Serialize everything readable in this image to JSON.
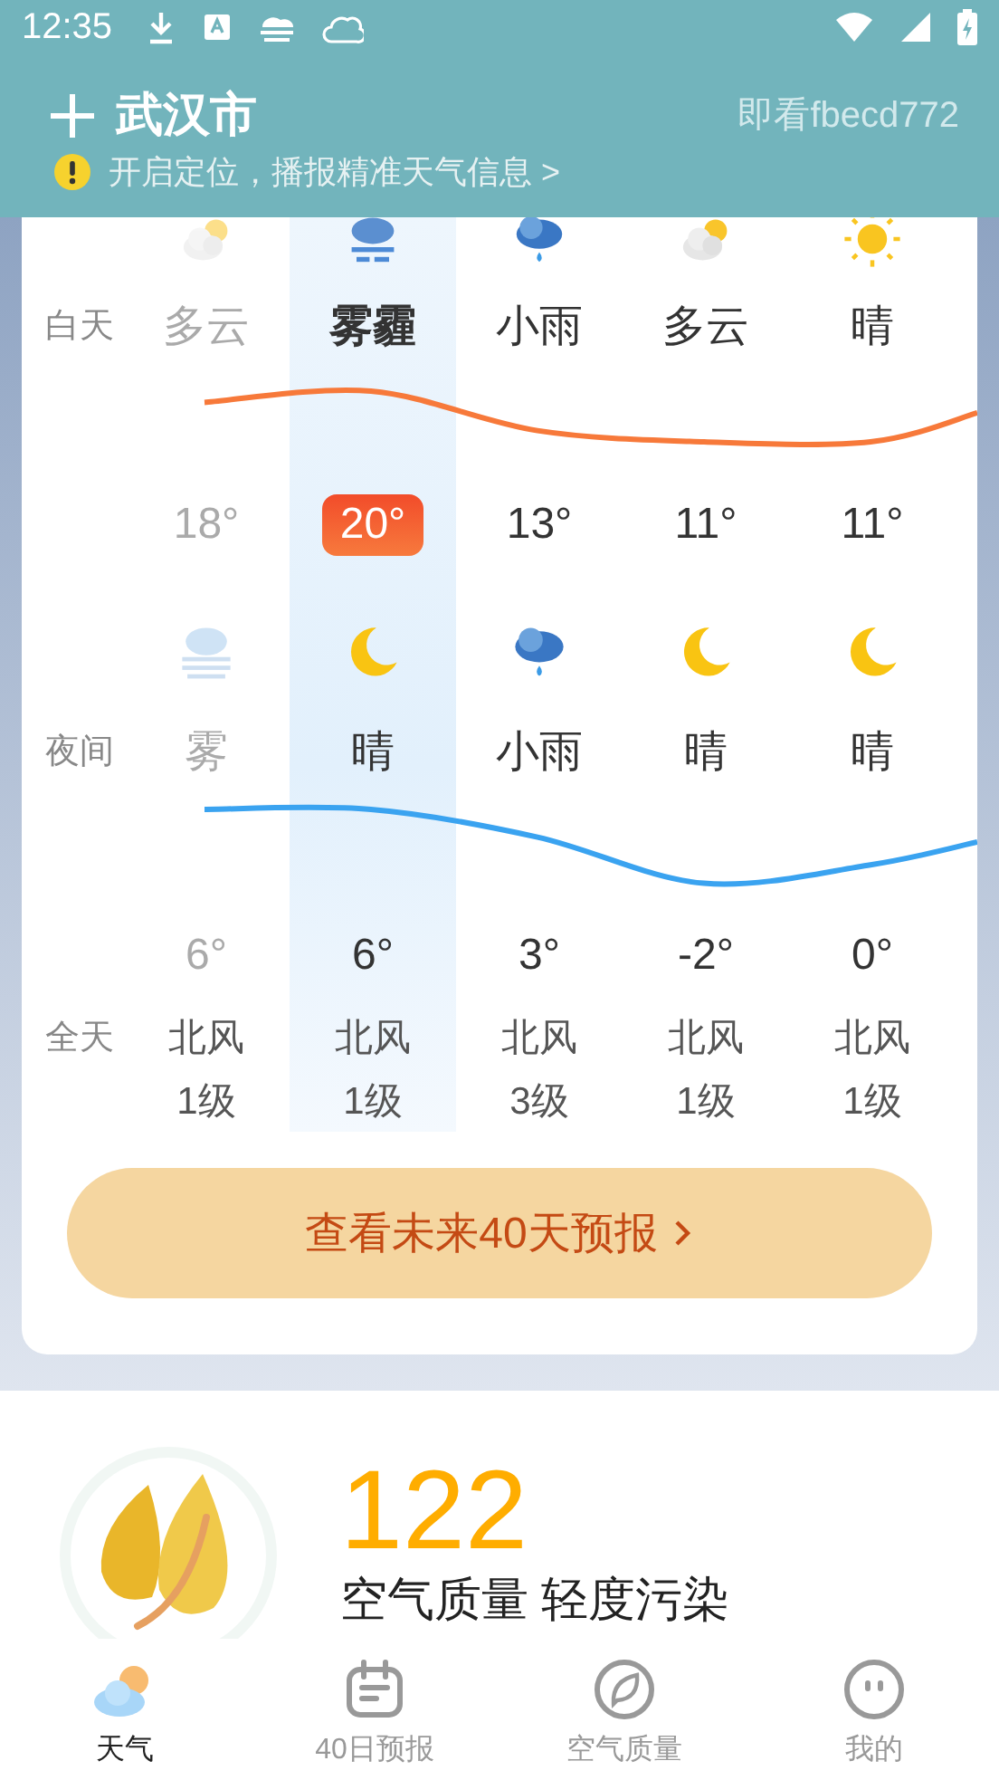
{
  "status_bar": {
    "time": "12:35"
  },
  "header": {
    "city": "武汉市",
    "watermark_id": "即看fbecd772",
    "location_tip": "开启定位，播报精准天气信息 >"
  },
  "row_labels": {
    "day": "白天",
    "night": "夜间",
    "all_day": "全天"
  },
  "days": [
    {
      "past": true,
      "selected": false,
      "day": {
        "kind": "cloudy",
        "condition": "多云"
      },
      "high": "18°",
      "night": {
        "kind": "fog",
        "condition": "雾"
      },
      "low": "6°",
      "wind_direction": "北风",
      "wind_level": "1级"
    },
    {
      "past": false,
      "selected": true,
      "day": {
        "kind": "haze",
        "condition": "雾霾"
      },
      "high": "20°",
      "night": {
        "kind": "moon",
        "condition": "晴"
      },
      "low": "6°",
      "wind_direction": "北风",
      "wind_level": "1级"
    },
    {
      "past": false,
      "selected": false,
      "day": {
        "kind": "rain",
        "condition": "小雨"
      },
      "high": "13°",
      "night": {
        "kind": "rain",
        "condition": "小雨"
      },
      "low": "3°",
      "wind_direction": "北风",
      "wind_level": "3级"
    },
    {
      "past": false,
      "selected": false,
      "day": {
        "kind": "cloudy",
        "condition": "多云"
      },
      "high": "11°",
      "night": {
        "kind": "moon",
        "condition": "晴"
      },
      "low": "-2°",
      "wind_direction": "北风",
      "wind_level": "1级"
    },
    {
      "past": false,
      "selected": false,
      "day": {
        "kind": "sunny",
        "condition": "晴"
      },
      "high": "11°",
      "night": {
        "kind": "moon",
        "condition": "晴"
      },
      "low": "0°",
      "wind_direction": "北风",
      "wind_level": "1级"
    }
  ],
  "forecast_button": "查看未来40天预报",
  "aqi": {
    "value": "122",
    "label": "空气质量 轻度污染"
  },
  "nav": [
    {
      "kind": "weather",
      "label": "天气",
      "selected": true
    },
    {
      "kind": "calendar",
      "label": "40日预报",
      "selected": false
    },
    {
      "kind": "leaf",
      "label": "空气质量",
      "selected": false
    },
    {
      "kind": "face",
      "label": "我的",
      "selected": false
    }
  ]
}
